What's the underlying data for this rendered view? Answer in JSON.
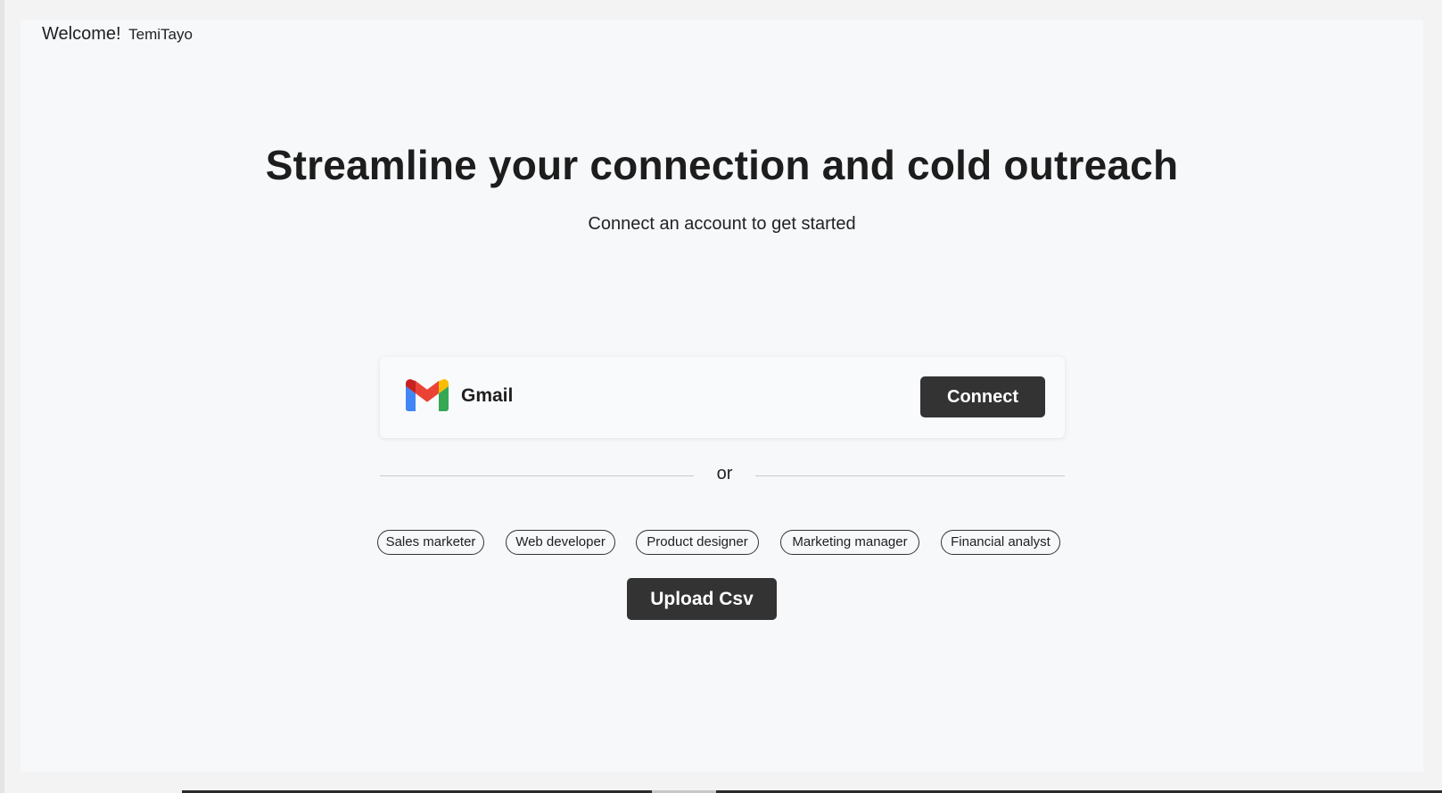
{
  "header": {
    "welcome_text": "Welcome!",
    "username": "TemiTayo"
  },
  "hero": {
    "title": "Streamline your connection and cold outreach",
    "subtitle": "Connect an account to get started"
  },
  "account_card": {
    "provider_icon": "gmail-icon",
    "provider_label": "Gmail",
    "connect_label": "Connect"
  },
  "divider": {
    "label": "or"
  },
  "roles": [
    "Sales marketer",
    "Web developer",
    "Product designer",
    "Marketing manager",
    "Financial analyst"
  ],
  "upload": {
    "label": "Upload Csv"
  },
  "colors": {
    "button_bg": "#333333",
    "button_text": "#ffffff",
    "page_bg": "#f7f8fa",
    "gmail_red": "#EA4335",
    "gmail_blue": "#4285F4",
    "gmail_green": "#34A853",
    "gmail_yellow": "#FBBC04"
  }
}
